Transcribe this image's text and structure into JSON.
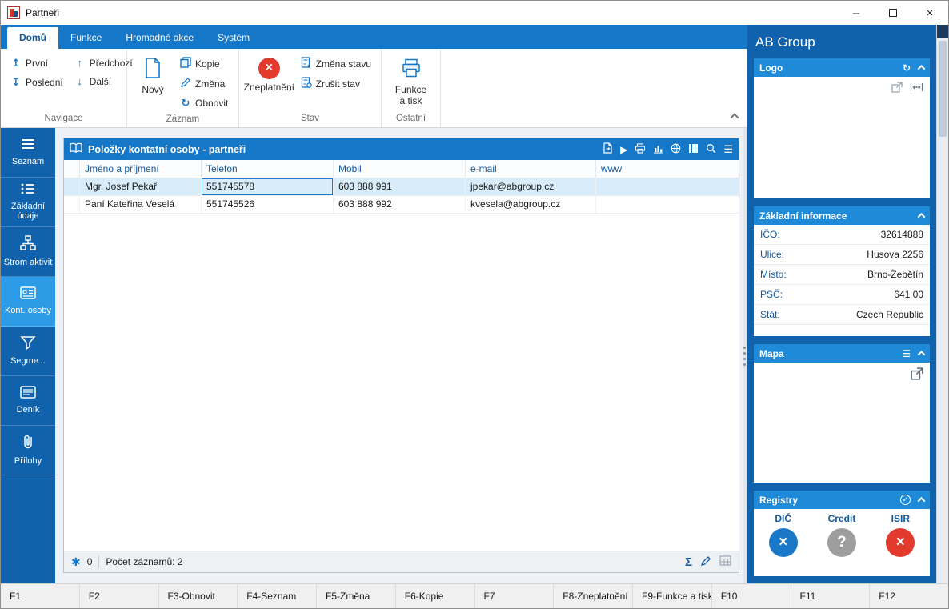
{
  "window": {
    "title": "Partneři"
  },
  "icons": {
    "first": "↥",
    "last": "↧",
    "previous": "↑",
    "next": "↓",
    "refresh": "↻",
    "play": "▶",
    "menu": "☰",
    "sum": "Σ",
    "minimize": "–",
    "close": "×",
    "cross": "×",
    "question": "?",
    "asterisk": "✱",
    "check": "✓"
  },
  "colors": {
    "accent": "#1577c8",
    "sidebar": "#0f62ab",
    "section_header": "#1e8ad8",
    "selected_row": "#d9ecf9",
    "danger": "#e23b2e",
    "neutral": "#9e9e9e"
  },
  "ribbon": {
    "tabs": [
      {
        "label": "Domů",
        "active": true
      },
      {
        "label": "Funkce"
      },
      {
        "label": "Hromadné akce"
      },
      {
        "label": "Systém"
      }
    ],
    "groups": [
      {
        "caption": "Navigace",
        "items": [
          {
            "label": "První"
          },
          {
            "label": "Poslední"
          },
          {
            "label": "Předchozí"
          },
          {
            "label": "Další"
          }
        ]
      },
      {
        "caption": "Záznam",
        "items": [
          {
            "label": "Nový"
          },
          {
            "label": "Kopie"
          },
          {
            "label": "Změna"
          },
          {
            "label": "Obnovit"
          }
        ]
      },
      {
        "caption": "Stav",
        "items": [
          {
            "label": "Zneplatnění"
          },
          {
            "label": "Změna stavu"
          },
          {
            "label": "Zrušit stav"
          }
        ]
      },
      {
        "caption": "Ostatní",
        "items": [
          {
            "label": "Funkce a tisk"
          }
        ]
      }
    ]
  },
  "sidebar": {
    "items": [
      {
        "label": "Seznam"
      },
      {
        "label": "Základní údaje"
      },
      {
        "label": "Strom aktivit"
      },
      {
        "label": "Kont. osoby",
        "active": true
      },
      {
        "label": "Segme..."
      },
      {
        "label": "Deník"
      },
      {
        "label": "Přílohy"
      }
    ]
  },
  "grid": {
    "title": "Položky kontatní osoby - partneři",
    "columns": [
      "Jméno a příjmení",
      "Telefon",
      "Mobil",
      "e-mail",
      "www"
    ],
    "rows": [
      {
        "cells": [
          "Mgr. Josef Pekař",
          "551745578",
          "603 888 991",
          "jpekar@abgroup.cz",
          ""
        ]
      },
      {
        "cells": [
          "Paní Kateřina Veselá",
          "551745526",
          "603 888 992",
          "kvesela@abgroup.cz",
          ""
        ]
      }
    ],
    "status": {
      "filter_count": "0",
      "records": "Počet záznamů: 2"
    }
  },
  "panel": {
    "title": "AB Group",
    "logo": {
      "title": "Logo"
    },
    "info": {
      "title": "Základní informace",
      "fields": [
        {
          "label": "IČO:",
          "value": "32614888"
        },
        {
          "label": "Ulice:",
          "value": "Husova 2256"
        },
        {
          "label": "Místo:",
          "value": "Brno-Žebětín"
        },
        {
          "label": "PSČ:",
          "value": "641 00"
        },
        {
          "label": "Stát:",
          "value": "Czech Republic"
        }
      ]
    },
    "mapa": {
      "title": "Mapa"
    },
    "registry": {
      "title": "Registry",
      "badges": [
        {
          "label": "DIČ",
          "glyph": "×",
          "color": "#1b78c8"
        },
        {
          "label": "Credit",
          "glyph": "?",
          "color": "#9e9e9e"
        },
        {
          "label": "ISIR",
          "glyph": "×",
          "color": "#e23b2e"
        }
      ]
    }
  },
  "fkeys": [
    "F1",
    "F2",
    "F3-Obnovit",
    "F4-Seznam",
    "F5-Změna",
    "F6-Kopie",
    "F7",
    "F8-Zneplatnění",
    "F9-Funkce a tisk",
    "F10",
    "F11",
    "F12"
  ]
}
